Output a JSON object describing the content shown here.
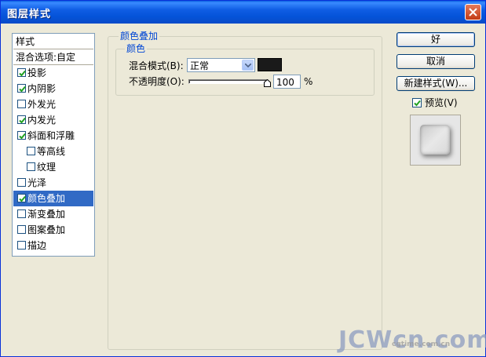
{
  "window": {
    "title": "图层样式"
  },
  "style_list": {
    "items": [
      {
        "label": "样式",
        "has_checkbox": false,
        "checked": false,
        "indent": 0,
        "selected": false
      },
      {
        "label": "混合选项:自定",
        "has_checkbox": false,
        "checked": false,
        "indent": 0,
        "selected": false
      },
      {
        "label": "投影",
        "has_checkbox": true,
        "checked": true,
        "indent": 0,
        "selected": false
      },
      {
        "label": "内阴影",
        "has_checkbox": true,
        "checked": true,
        "indent": 0,
        "selected": false
      },
      {
        "label": "外发光",
        "has_checkbox": true,
        "checked": false,
        "indent": 0,
        "selected": false
      },
      {
        "label": "内发光",
        "has_checkbox": true,
        "checked": true,
        "indent": 0,
        "selected": false
      },
      {
        "label": "斜面和浮雕",
        "has_checkbox": true,
        "checked": true,
        "indent": 0,
        "selected": false
      },
      {
        "label": "等高线",
        "has_checkbox": true,
        "checked": false,
        "indent": 1,
        "selected": false
      },
      {
        "label": "纹理",
        "has_checkbox": true,
        "checked": false,
        "indent": 1,
        "selected": false
      },
      {
        "label": "光泽",
        "has_checkbox": true,
        "checked": false,
        "indent": 0,
        "selected": false
      },
      {
        "label": "颜色叠加",
        "has_checkbox": true,
        "checked": true,
        "indent": 0,
        "selected": true
      },
      {
        "label": "渐变叠加",
        "has_checkbox": true,
        "checked": false,
        "indent": 0,
        "selected": false
      },
      {
        "label": "图案叠加",
        "has_checkbox": true,
        "checked": false,
        "indent": 0,
        "selected": false
      },
      {
        "label": "描边",
        "has_checkbox": true,
        "checked": false,
        "indent": 0,
        "selected": false
      }
    ]
  },
  "panel": {
    "title": "颜色叠加",
    "group_title": "颜色",
    "blend_mode_label": "混合模式(B):",
    "blend_mode_value": "正常",
    "overlay_color": "#1A1A1A",
    "opacity_label": "不透明度(O):",
    "opacity_value": "100",
    "opacity_unit": "%",
    "opacity_level": 1.0
  },
  "buttons": {
    "ok": "好",
    "cancel": "取消",
    "new_style": "新建样式(W)..."
  },
  "preview": {
    "label": "预览(V)",
    "checked": true
  },
  "watermark": {
    "line1": "JCWcn.com",
    "line2": "cgtime.com.cn"
  },
  "colors": {
    "accent": "#316AC5",
    "title_bar": "#0453D8",
    "group_title": "#0046D5"
  }
}
